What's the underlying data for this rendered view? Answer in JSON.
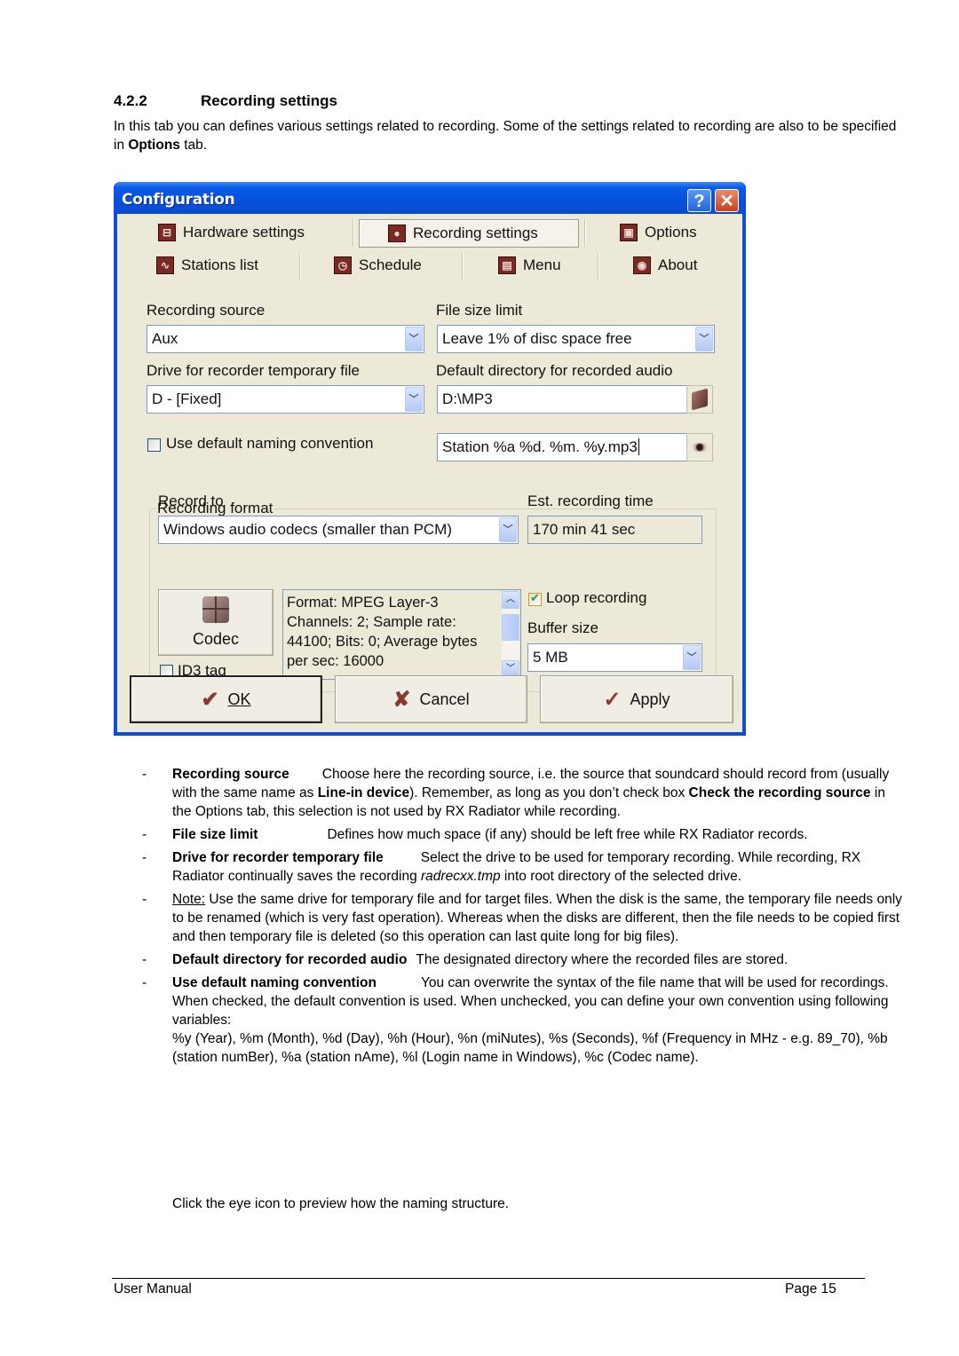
{
  "section": {
    "number": "4.2.2",
    "title": "Recording settings",
    "intro_part1": "In this tab you can defines various settings related to recording. Some of the settings related to recording are also to be specified in ",
    "intro_bold": "Options",
    "intro_part2": " tab."
  },
  "window": {
    "title": "Configuration",
    "help_label": "?",
    "close_label": "✕",
    "tabs": [
      {
        "label": "Hardware settings",
        "icon": "hardware-icon",
        "glyph": "⊟",
        "active": false
      },
      {
        "label": "Recording settings",
        "icon": "record-icon",
        "glyph": "●",
        "active": true
      },
      {
        "label": "Options",
        "icon": "computer-icon",
        "glyph": "▣",
        "active": false
      },
      {
        "label": "Stations list",
        "icon": "waveform-icon",
        "glyph": "∿",
        "active": false
      },
      {
        "label": "Schedule",
        "icon": "clock-icon",
        "glyph": "◷",
        "active": false
      },
      {
        "label": "Menu",
        "icon": "menu-icon",
        "glyph": "▤",
        "active": false
      },
      {
        "label": "About",
        "icon": "radio-icon",
        "glyph": "◉",
        "active": false
      }
    ],
    "recording_source": {
      "label": "Recording source",
      "value": "Aux"
    },
    "file_size_limit": {
      "label": "File size limit",
      "value": "Leave 1% of disc space free"
    },
    "temp_drive": {
      "label": "Drive for recorder temporary file",
      "value": "D - [Fixed]"
    },
    "default_dir": {
      "label": "Default directory for recorded audio",
      "value": "D:\\MP3"
    },
    "naming": {
      "label": "Use default naming convention",
      "checked": false,
      "value": "Station %a %d. %m. %y.mp3"
    },
    "format_group": {
      "title": "Recording format",
      "record_to_label": "Record to",
      "record_to_value": "Windows audio codecs (smaller than PCM)",
      "est_time_label": "Est. recording time",
      "est_time_value": "170 min 41 sec",
      "codec_button": "Codec",
      "id3_label": "ID3 tag",
      "id3_checked": false,
      "codec_info": "Format: MPEG Layer-3 Channels: 2; Sample rate: 44100; Bits: 0; Average bytes per sec: 16000",
      "loop_label": "Loop recording",
      "loop_checked": true,
      "buffer_label": "Buffer size",
      "buffer_value": "5 MB"
    },
    "buttons": {
      "ok": "OK",
      "cancel": "Cancel",
      "apply": "Apply"
    }
  },
  "items": [
    {
      "term": "Recording source",
      "text_pre": "Choose here the recording source, i.e. the source that soundcard should record from (usually with the same name as ",
      "bold1": "Line-in device",
      "text_mid": "). Remember, as long as you don’t check box ",
      "bold2": "Check the recording source",
      "text_post": " in the Options tab, this selection is not used by RX Radiator while recording."
    },
    {
      "term": "File size limit",
      "text": "Defines how much space (if any) should be left free while RX Radiator records."
    },
    {
      "term": "Drive for recorder temporary file",
      "text_pre": "Select the drive to be used for temporary recording. While recording, RX Radiator continually saves the recording ",
      "italic": "radrecxx.tmp",
      "text_post": " into root directory of the selected drive."
    },
    {
      "note_label": "Note:",
      "text": " Use the same drive for temporary file and for target files. When the disk is the same, the temporary file needs only to be renamed (which is very fast operation). Whereas when the disks are different, then the file needs to be copied first and then temporary file is deleted (so this operation can last quite long for big files)."
    },
    {
      "term": "Default directory for recorded audio",
      "text": "The designated directory where the recorded files are stored."
    },
    {
      "term": "Use default naming convention",
      "text": "You can overwrite the syntax of the file name that will be used for recordings. When checked, the default convention is used.  When unchecked, you can define your own convention using following variables:",
      "vars": "%y (Year), %m (Month), %d (Day), %h (Hour), %n (miNutes), %s (Seconds), %f (Frequency in MHz - e.g. 89_70), %b (station numBer), %a (station nAme), %l (Login name in Windows), %c (Codec name)."
    }
  ],
  "eye_note": "Click the eye icon to preview how the naming structure.",
  "footer": {
    "left": "User Manual",
    "right": "Page 15"
  }
}
